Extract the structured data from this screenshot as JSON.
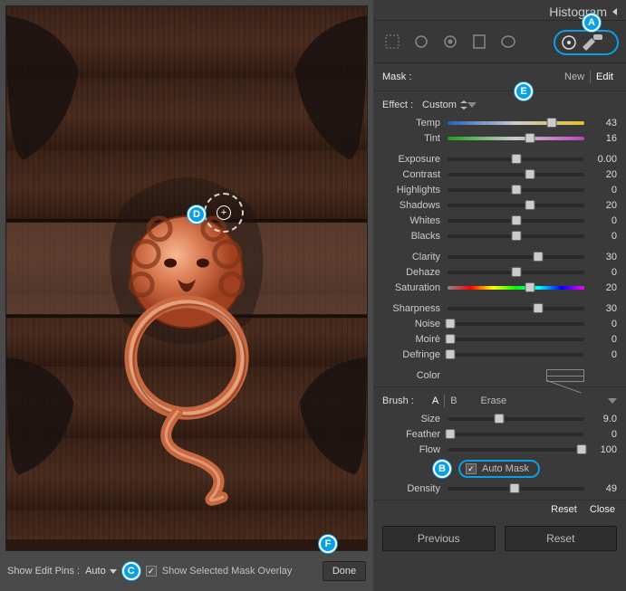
{
  "header": {
    "title": "Histogram"
  },
  "mask": {
    "label": "Mask :",
    "new": "New",
    "edit": "Edit"
  },
  "effect": {
    "label": "Effect :",
    "preset": "Custom"
  },
  "sliders_tone": [
    {
      "name": "Temp",
      "value": "43",
      "pos": 76,
      "track": "rainbow1"
    },
    {
      "name": "Tint",
      "value": "16",
      "pos": 60,
      "track": "rainbow2"
    }
  ],
  "sliders_light": [
    {
      "name": "Exposure",
      "value": "0.00",
      "pos": 50
    },
    {
      "name": "Contrast",
      "value": "20",
      "pos": 60
    },
    {
      "name": "Highlights",
      "value": "0",
      "pos": 50
    },
    {
      "name": "Shadows",
      "value": "20",
      "pos": 60
    },
    {
      "name": "Whites",
      "value": "0",
      "pos": 50
    },
    {
      "name": "Blacks",
      "value": "0",
      "pos": 50
    }
  ],
  "sliders_presence": [
    {
      "name": "Clarity",
      "value": "30",
      "pos": 66
    },
    {
      "name": "Dehaze",
      "value": "0",
      "pos": 50
    },
    {
      "name": "Saturation",
      "value": "20",
      "pos": 60,
      "track": "satur"
    }
  ],
  "sliders_detail": [
    {
      "name": "Sharpness",
      "value": "30",
      "pos": 66
    },
    {
      "name": "Noise",
      "value": "0",
      "pos": 2
    },
    {
      "name": "Moirè",
      "value": "0",
      "pos": 2
    },
    {
      "name": "Defringe",
      "value": "0",
      "pos": 2
    }
  ],
  "color": {
    "label": "Color"
  },
  "brush": {
    "label": "Brush :",
    "a": "A",
    "b": "B",
    "erase": "Erase",
    "sliders": [
      {
        "name": "Size",
        "value": "9.0",
        "pos": 38
      },
      {
        "name": "Feather",
        "value": "0",
        "pos": 2
      },
      {
        "name": "Flow",
        "value": "100",
        "pos": 98
      }
    ],
    "automask": "Auto Mask",
    "density": {
      "name": "Density",
      "value": "49",
      "pos": 49
    }
  },
  "actions": {
    "reset": "Reset",
    "close": "Close"
  },
  "nav": {
    "prev": "Previous",
    "reset": "Reset"
  },
  "bottom": {
    "pins_label": "Show Edit Pins :",
    "pins_mode": "Auto",
    "overlay": "Show Selected Mask Overlay",
    "done": "Done"
  },
  "callouts": {
    "a": "A",
    "b": "B",
    "c": "C",
    "d": "D",
    "e": "E",
    "f": "F"
  }
}
